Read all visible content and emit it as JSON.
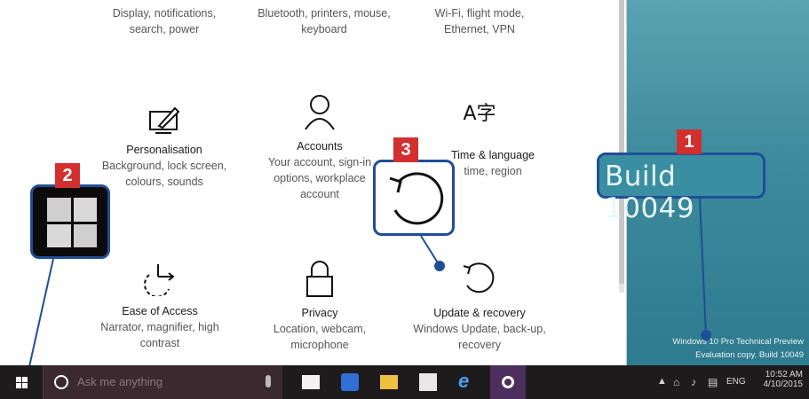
{
  "top_partials": [
    {
      "desc": "Display, notifications, search, power"
    },
    {
      "desc": "Bluetooth, printers, mouse, keyboard"
    },
    {
      "desc": "Wi-Fi, flight mode, Ethernet, VPN"
    }
  ],
  "categories": {
    "personalisation": {
      "title": "Personalisation",
      "desc": "Background, lock screen, colours, sounds"
    },
    "accounts": {
      "title": "Accounts",
      "desc": "Your account, sign-in options, workplace account"
    },
    "time_language": {
      "title": "Time & language",
      "desc": "time, region"
    },
    "ease_of_access": {
      "title": "Ease of Access",
      "desc": "Narrator, magnifier, high contrast"
    },
    "privacy": {
      "title": "Privacy",
      "desc": "Location, webcam, microphone"
    },
    "update_recovery": {
      "title": "Update & recovery",
      "desc": "Windows Update, back-up, recovery"
    }
  },
  "callouts": {
    "badge1": "1",
    "badge2": "2",
    "badge3": "3",
    "build_zoom": "Build 10049"
  },
  "watermark": {
    "line1": "Windows 10 Pro Technical Preview",
    "line2": "Evaluation copy. Build 10049"
  },
  "taskbar": {
    "search_placeholder": "Ask me anything",
    "language": "ENG",
    "time": "10:52 AM",
    "date": "4/10/2015"
  },
  "colors": {
    "badge": "#d32f2f",
    "callout_border": "#1f4e96",
    "taskbar": "#1e1b1d",
    "desktop": "#3c8a9c"
  }
}
